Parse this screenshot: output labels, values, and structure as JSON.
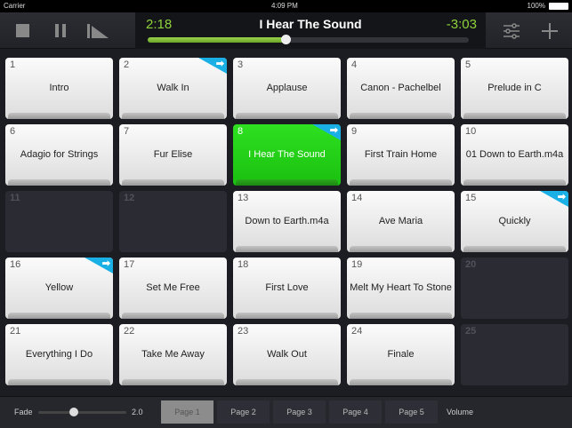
{
  "status": {
    "carrier": "Carrier",
    "time": "4:09 PM",
    "battery": "100%"
  },
  "player": {
    "elapsed": "2:18",
    "title": "I Hear The Sound",
    "remaining": "-3:03",
    "progress": 0.43
  },
  "tiles": [
    {
      "n": "1",
      "name": "Intro"
    },
    {
      "n": "2",
      "name": "Walk In",
      "arrow": true
    },
    {
      "n": "3",
      "name": "Applause"
    },
    {
      "n": "4",
      "name": "Canon - Pachelbel"
    },
    {
      "n": "5",
      "name": "Prelude in C"
    },
    {
      "n": "6",
      "name": "Adagio for Strings"
    },
    {
      "n": "7",
      "name": "Fur Elise"
    },
    {
      "n": "8",
      "name": "I Hear The Sound",
      "arrow": true,
      "active": true
    },
    {
      "n": "9",
      "name": "First Train Home"
    },
    {
      "n": "10",
      "name": "01 Down to Earth.m4a"
    },
    {
      "n": "11",
      "empty": true
    },
    {
      "n": "12",
      "empty": true
    },
    {
      "n": "13",
      "name": "Down to Earth.m4a"
    },
    {
      "n": "14",
      "name": "Ave Maria"
    },
    {
      "n": "15",
      "name": "Quickly",
      "arrow": true
    },
    {
      "n": "16",
      "name": "Yellow",
      "arrow": true
    },
    {
      "n": "17",
      "name": "Set Me Free"
    },
    {
      "n": "18",
      "name": "First Love"
    },
    {
      "n": "19",
      "name": "Melt My Heart To Stone"
    },
    {
      "n": "20",
      "empty": true
    },
    {
      "n": "21",
      "name": "Everything I Do"
    },
    {
      "n": "22",
      "name": "Take Me Away"
    },
    {
      "n": "23",
      "name": "Walk Out"
    },
    {
      "n": "24",
      "name": "Finale"
    },
    {
      "n": "25",
      "empty": true
    }
  ],
  "bottom": {
    "fade_label": "Fade",
    "fade_value": "2.0",
    "fade_level": 0.4,
    "pages": [
      "Page 1",
      "Page 2",
      "Page 3",
      "Page 4",
      "Page 5"
    ],
    "selected_page": 0,
    "volume_label": "Volume"
  },
  "colors": {
    "accent_green": "#8ed23c",
    "active_tile": "#22d018",
    "arrow_badge": "#1ab0e6"
  }
}
